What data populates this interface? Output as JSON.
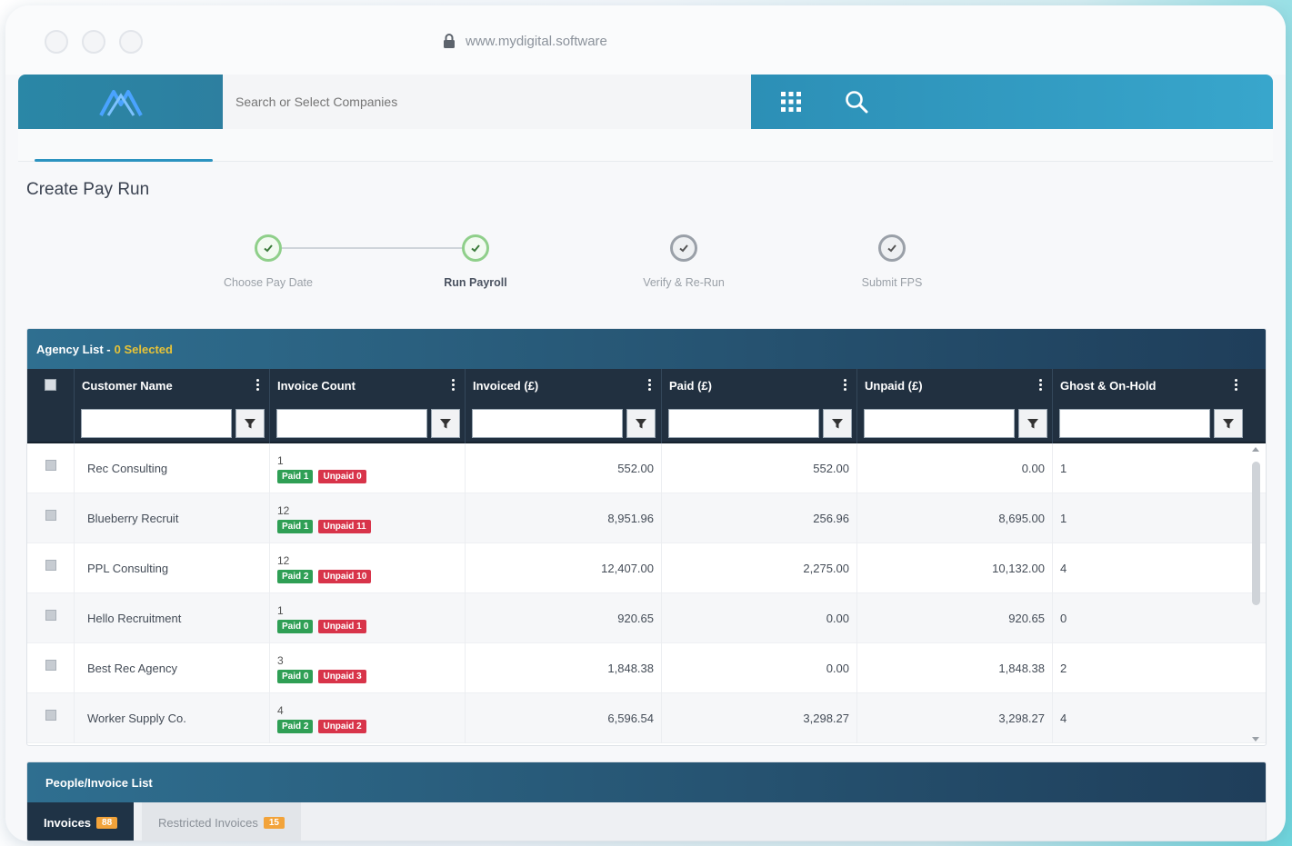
{
  "browser": {
    "url": "www.mydigital.software"
  },
  "topbar": {
    "search_placeholder": "Search or Select Companies",
    "apps_icon": "grid-icon",
    "search_icon": "search-icon"
  },
  "page": {
    "title": "Create Pay Run"
  },
  "stepper": {
    "steps": [
      {
        "label": "Choose Pay Date",
        "state": "done"
      },
      {
        "label": "Run Payroll",
        "state": "done",
        "active": true
      },
      {
        "label": "Verify & Re-Run",
        "state": "todo"
      },
      {
        "label": "Submit FPS",
        "state": "todo"
      }
    ]
  },
  "agency": {
    "title": "Agency List -",
    "selected": "0 Selected",
    "columns": [
      "Customer Name",
      "Invoice Count",
      "Invoiced (£)",
      "Paid (£)",
      "Unpaid (£)",
      "Ghost & On-Hold"
    ],
    "rows": [
      {
        "name": "Rec Consulting",
        "count": "1",
        "paid_badge": "Paid 1",
        "unpaid_badge": "Unpaid 0",
        "invoiced": "552.00",
        "paid": "552.00",
        "unpaid": "0.00",
        "ghost": "1"
      },
      {
        "name": "Blueberry Recruit",
        "count": "12",
        "paid_badge": "Paid 1",
        "unpaid_badge": "Unpaid 11",
        "invoiced": "8,951.96",
        "paid": "256.96",
        "unpaid": "8,695.00",
        "ghost": "1"
      },
      {
        "name": "PPL Consulting",
        "count": "12",
        "paid_badge": "Paid 2",
        "unpaid_badge": "Unpaid 10",
        "invoiced": "12,407.00",
        "paid": "2,275.00",
        "unpaid": "10,132.00",
        "ghost": "4"
      },
      {
        "name": "Hello Recruitment",
        "count": "1",
        "paid_badge": "Paid 0",
        "unpaid_badge": "Unpaid 1",
        "invoiced": "920.65",
        "paid": "0.00",
        "unpaid": "920.65",
        "ghost": "0"
      },
      {
        "name": "Best Rec Agency",
        "count": "3",
        "paid_badge": "Paid 0",
        "unpaid_badge": "Unpaid 3",
        "invoiced": "1,848.38",
        "paid": "0.00",
        "unpaid": "1,848.38",
        "ghost": "2"
      },
      {
        "name": "Worker Supply Co.",
        "count": "4",
        "paid_badge": "Paid 2",
        "unpaid_badge": "Unpaid 2",
        "invoiced": "6,596.54",
        "paid": "3,298.27",
        "unpaid": "3,298.27",
        "ghost": "4"
      }
    ]
  },
  "people": {
    "title": "People/Invoice List",
    "tabs": [
      {
        "label": "Invoices",
        "count": "88",
        "active": true
      },
      {
        "label": "Restricted Invoices",
        "count": "15",
        "active": false
      }
    ]
  },
  "colors": {
    "accent": "#2c93c0",
    "header_dark": "#213040",
    "paid": "#2f9f55",
    "unpaid": "#d8344a",
    "selected_text": "#e7c338",
    "count_badge": "#f2a33a"
  }
}
